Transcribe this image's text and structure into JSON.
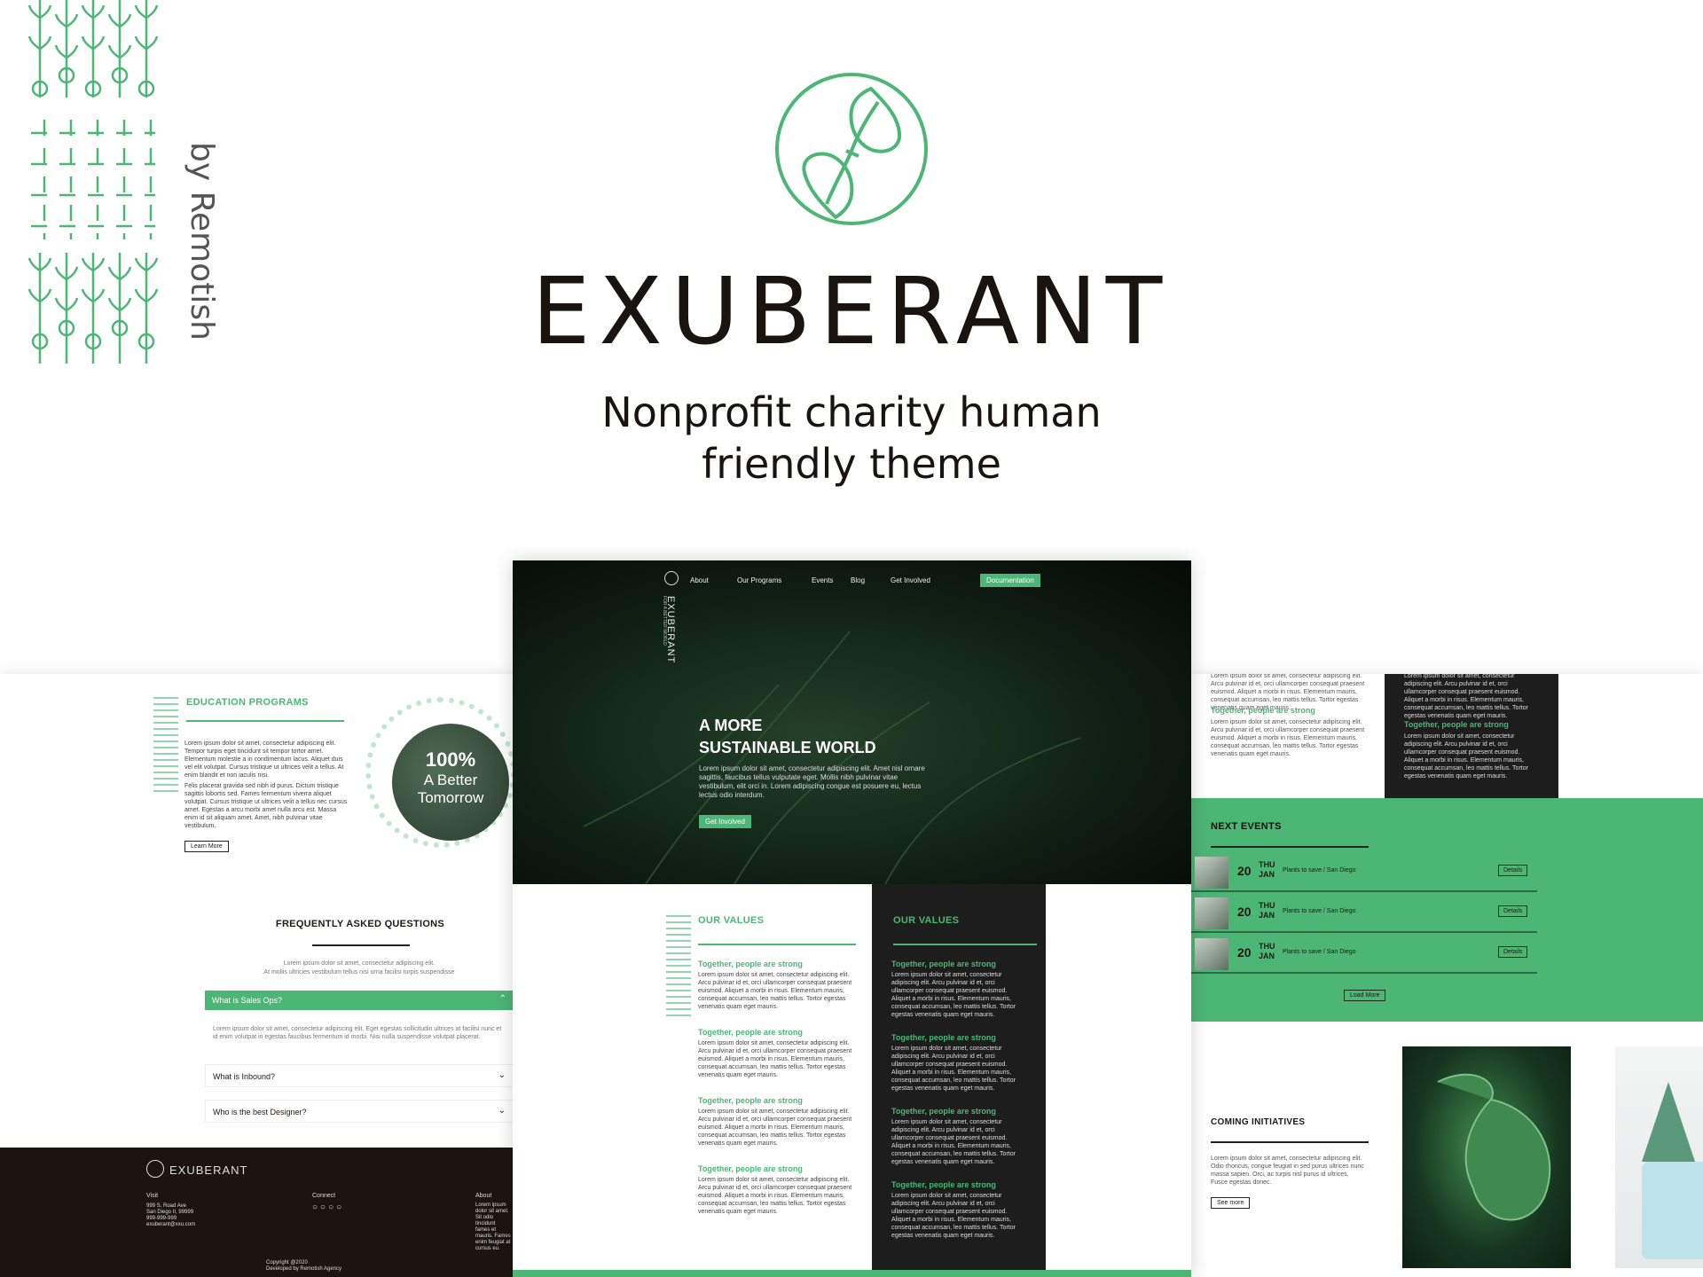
{
  "brand": {
    "byline": "by Remotish",
    "title": "EXUBERANT",
    "subtitle_line1": "Nonprofit charity human",
    "subtitle_line2": "friendly theme",
    "accent": "#4cb675",
    "dark": "#1d1d1d"
  },
  "nav": {
    "items": [
      "About",
      "Our Programs",
      "Events",
      "Blog",
      "Get Involved"
    ],
    "doc_button": "Documentation",
    "logo_text": "EXUBERANT",
    "logo_tag": "FOR A BETTER WORLD"
  },
  "hero": {
    "line1": "A MORE",
    "line2": "SUSTAINABLE WORLD",
    "body": "Lorem ipsum dolor sit amet, consectetur adipiscing elit. Amet nisl ornare sagittis, faucibus tellus vulputate eget. Mollis nibh pulvinar vitae vestibulum, elit orci in. Lorem adipiscing congue est posuere eu, lectus lectus odio interdum.",
    "cta": "Get Involved"
  },
  "education": {
    "heading": "EDUCATION PROGRAMS",
    "p1": "Lorem ipsum dolor sit amet, consectetur adipiscing elit. Tempor turpis eget tincidunt sit tempor tortor amet. Elementum molestie a in condimentum lacus. Aliquet duis vel elit volutpat. Cursus tristique ut ultrices velit a tellus. At enim blandit et non iaculis nisi.",
    "p2": "Felis placerat gravida sed nibh id purus. Dictum tristique sagittis lobortis sed. Fames fermentum viverra aliquet volutpat. Cursus tristique ut ultrices velit a tellus nec cursus amet. Egestas a arcu morbi amet nulla arcu est. Massa enim id sit aliquam amet. Amet, nibh pulvinar vitae vestibulum.",
    "button": "Learn More",
    "stat": "100%",
    "stat_l1": "A Better",
    "stat_l2": "Tomorrow"
  },
  "faq": {
    "heading": "FREQUENTLY ASKED QUESTIONS",
    "intro1": "Lorem ipsum dolor sit amet, consectetur adipiscing elit.",
    "intro2": "At mollis ultricies vestibulum tellus  nisi urna facilisi turpis suspendisse",
    "q1": "What is Sales Ops?",
    "a1": "Lorem ipsum dolor sit amet, consectetur adipiscing elit. Eget egestas sollicitudin ultrices at facilisi nunc et id enim volutpat in egestas faucibus fermentum id morbi. Nisi nulla suspendisse volutpat placerat.",
    "q2": "What is Inbound?",
    "q3": "Who is the best Designer?"
  },
  "footer": {
    "brand": "EXUBERANT",
    "visit": "Visit",
    "addr1": "999 S. Road Ave",
    "addr2": "San Diego II, 99999",
    "phone": "999-999-999",
    "email": "exuberant@xxu.com",
    "connect": "Connect",
    "about": "About",
    "about_text": "Lorem ipsum dolor sit amet. Sit odio tincidunt fames et mauris. Fames enim feugiat at cursus eu.",
    "copy1": "Copyright @2020",
    "copy2": "Developed by Remotish Agency"
  },
  "values": {
    "heading": "OUR VALUES",
    "item_title": "Together, people are strong",
    "item_body": "Lorem ipsum dolor sit amet, consectetur adipiscing elit. Arcu pulvinar id et, orci ullamcorper consequat praesent euismod. Aliquet a morbi in risus. Elementum mauris, consequat accumsan, leo mattis tellus. Tortor egestas venenatis quam eget mauris."
  },
  "events": {
    "heading": "NEXT EVENTS",
    "rows": [
      {
        "day": "20",
        "dow": "THU",
        "mon": "JAN",
        "title": "Plants to save / San Diego",
        "button": "Details"
      },
      {
        "day": "20",
        "dow": "THU",
        "mon": "JAN",
        "title": "Plants to save / San Diego",
        "button": "Details"
      },
      {
        "day": "20",
        "dow": "THU",
        "mon": "JAN",
        "title": "Plants to save / San Diego",
        "button": "Details"
      }
    ],
    "load_more": "Load More"
  },
  "initiatives": {
    "heading": "COMING INITIATIVES",
    "body": "Lorem ipsum dolor sit amet, consectetur adipiscing elit. Odio rhoncus, congue feugiat in sed purus ultrices nunc massa sapien. Orci, ac turpis nisl purus id ultrices. Fusce egestas donec.",
    "button": "See more"
  },
  "right_top": {
    "title": "Together, people are strong",
    "body": "Lorem ipsum dolor sit amet, consectetur adipiscing elit. Arcu pulvinar id et, orci ullamcorper consequat praesent euismod. Aliquet a morbi in risus. Elementum mauris, consequat accumsan, leo mattis tellus. Tortor egestas venenatis quam eget mauris."
  }
}
